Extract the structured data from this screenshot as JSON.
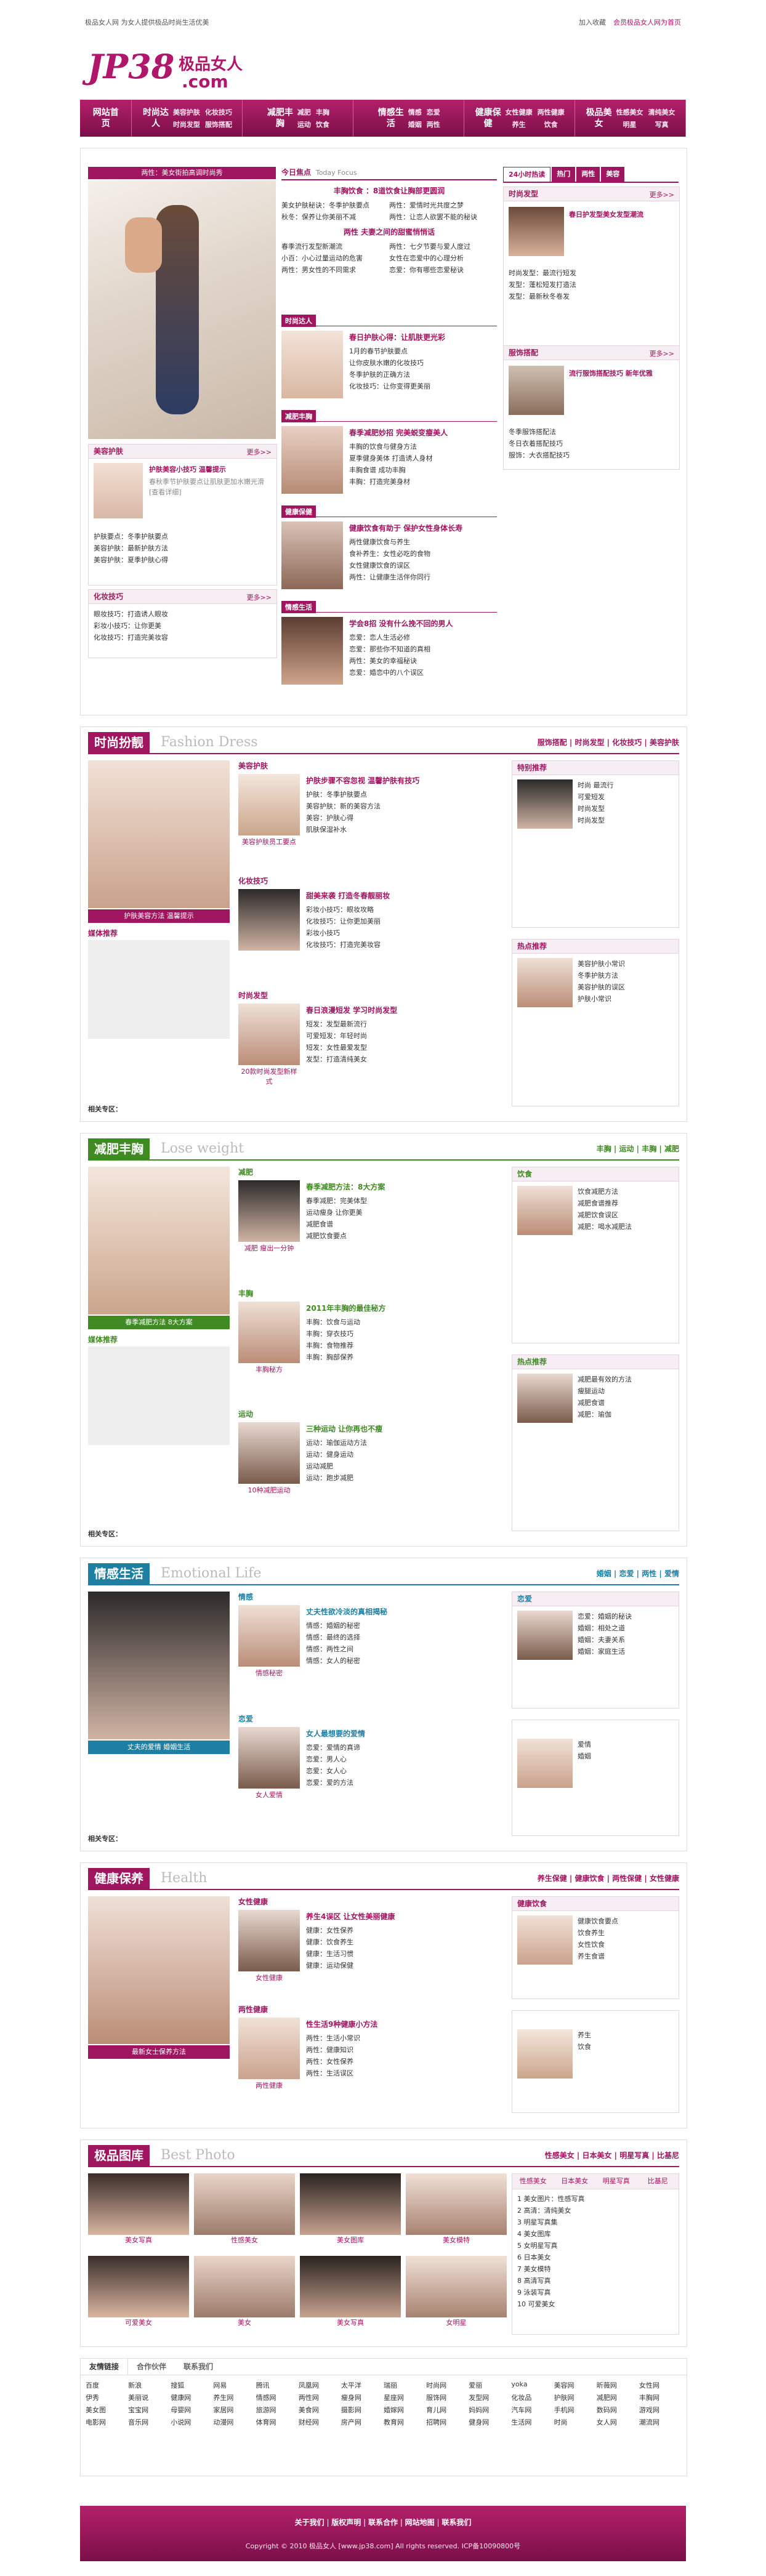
{
  "top": {
    "left": "极品女人网 为女人提供极品时尚生活优美",
    "right1": "加入收藏",
    "right2": "会员极品女人网为首页"
  },
  "logo": {
    "text": "JP38",
    "suffix": "极品女人",
    "com": ".com"
  },
  "nav": [
    {
      "label": "网站首页",
      "subs": []
    },
    {
      "label": "时尚达人",
      "subs": [
        "美容护肤",
        "化妆技巧",
        "时尚发型",
        "服饰搭配"
      ]
    },
    {
      "label": "减肥丰胸",
      "subs": [
        "减肥",
        "丰胸",
        "运动",
        "饮食"
      ]
    },
    {
      "label": "情感生活",
      "subs": [
        "情感",
        "恋爱",
        "婚姻",
        "两性"
      ]
    },
    {
      "label": "健康保健",
      "subs": [
        "女性健康",
        "两性健康",
        "养生",
        "饮食"
      ]
    },
    {
      "label": "极品美女",
      "subs": [
        "性感美女",
        "清纯美女",
        "明星",
        "写真"
      ]
    }
  ],
  "hero": {
    "caption": "两性：美女街拍高调时尚秀"
  },
  "focus": {
    "label": "今日焦点",
    "label_en": "Today Focus",
    "headline": "丰胸饮食 ：8道饮食让胸部更圆润",
    "items": [
      "美女护肤秘诀：冬季护肤要点",
      "两性：爱情时光共度之梦",
      "秋冬：保养让你美丽不减",
      "两性：让恋人欲罢不能的秘诀"
    ],
    "headline2": "两性 夫妻之间的甜蜜悄悄话",
    "items2": [
      "春季流行发型新潮流",
      "两性：七夕节要与爱人度过",
      "小百：小心过量运动的危害",
      "女性在恋爱中的心理分析",
      "两性：男女性的不同需求",
      "恋爱：你有哪些恋爱秘诀"
    ]
  },
  "mid_blocks": [
    {
      "label": "时尚达人",
      "title": "春日护肤心得：让肌肤更光彩",
      "items": [
        "1月的春节护肤要点",
        "让你皮肤水嫩的化妆技巧",
        "冬季护肤的正确方法",
        "化妆技巧：让你变得更美丽"
      ]
    },
    {
      "label": "减肥丰胸",
      "title": "春季减肥妙招 完美蜕变瘦美人",
      "items": [
        "丰胸的饮食与健身方法",
        "夏季健身美体 打造诱人身材",
        "丰胸食谱 成功丰胸",
        "丰胸：打造完美身材"
      ]
    },
    {
      "label": "健康保健",
      "title": "健康饮食有助于 保护女性身体长寿",
      "items": [
        "两性健康饮食与养生",
        "食补养生：女性必吃的食物",
        "女性健康饮食的误区",
        "两性：让健康生活伴你同行"
      ]
    },
    {
      "label": "情感生活",
      "title": "学会8招 没有什么挽不回的男人",
      "items": [
        "恋爱：恋人生活必修",
        "恋爱：那些你不知道的真相",
        "两性：美女的幸福秘诀",
        "恋爱：婚恋中的八个误区"
      ]
    }
  ],
  "left_panels": [
    {
      "title": "美容护肤",
      "more": "更多>>",
      "text": "护肤美容小技巧 温馨提示",
      "desc": "春秋季节护肤要点让肌肤更加水嫩光滑 [查看详细]",
      "items": [
        "护肤要点：冬季护肤要点",
        "美容护肤：最新护肤方法",
        "美容护肤：夏季护肤心得"
      ]
    },
    {
      "title": "化妆技巧",
      "more": "更多>>",
      "items": [
        "眼妆技巧：打造诱人眼妆",
        "彩妆小技巧：让你更美",
        "化妆技巧：打造完美妆容"
      ]
    }
  ],
  "right_tabs": [
    "24小时热读",
    "热门",
    "两性",
    "美容"
  ],
  "right_panels": [
    {
      "title": "时尚发型",
      "more": "更多>>",
      "text": "春日护发型美女发型潮流",
      "items": [
        "时尚发型：最流行短发",
        "发型：蓬松短发打造法",
        "发型：最新秋冬卷发"
      ]
    },
    {
      "title": "服饰搭配",
      "more": "更多>>",
      "text": "流行服饰搭配技巧 新年优雅",
      "items": [
        "冬季服饰搭配法",
        "冬日衣着搭配技巧",
        "服饰：大衣搭配技巧"
      ]
    }
  ],
  "sections": [
    {
      "key": "fashion",
      "cn": "时尚扮靓",
      "en": "Fashion Dress",
      "color": "#a0155f",
      "tabs": [
        "服饰搭配",
        "时尚发型",
        "化妆技巧",
        "美容护肤"
      ],
      "main_caption": "护肤美容方法 温馨提示",
      "sub_label": "媒体推荐",
      "footer": "相关专区：",
      "cols": [
        {
          "head": "美容护肤",
          "title": "护肤步骤不容忽视 温馨护肤有技巧",
          "items": [
            "护肤：冬季护肤要点",
            "美容护肤：新的美容方法",
            "美容：护肤心得",
            "肌肤保湿补水"
          ],
          "caption": "美容护肤员工要点"
        },
        {
          "head": "化妆技巧",
          "title": "甜美来袭 打造冬春靓丽妆",
          "items": [
            "彩妆小技巧：眼妆攻略",
            "化妆技巧：让你更加美丽",
            "彩妆小技巧",
            "化妆技巧：打造完美妆容"
          ],
          "caption": ""
        },
        {
          "head": "时尚发型",
          "title": "春日浪漫短发 学习时尚发型",
          "items": [
            "短发：发型最新流行",
            "可爱短发：年轻时尚",
            "短发：女性最爱发型",
            "发型：打造清纯美女"
          ],
          "caption": "20款时尚发型新样式"
        }
      ],
      "side": [
        {
          "title": "特别推荐",
          "items": [
            "时尚 最流行",
            "可爱短发",
            "时尚发型",
            "时尚发型"
          ]
        },
        {
          "title": "热点推荐",
          "items": [
            "美容护肤小常识",
            "冬季护肤方法",
            "美容护肤的误区",
            "护肤小常识"
          ]
        }
      ]
    },
    {
      "key": "slim",
      "cn": "减肥丰胸",
      "en": "Lose weight",
      "color": "#3f8a22",
      "tabs": [
        "丰胸",
        "运动",
        "丰胸",
        "减肥"
      ],
      "main_caption": "春季减肥方法 8大方案",
      "sub_label": "媒体推荐",
      "footer": "相关专区：",
      "cols": [
        {
          "head": "减肥",
          "title": "春季减肥方法：8大方案",
          "items": [
            "春季减肥：完美体型",
            "运动瘦身 让你更美",
            "减肥食谱",
            "减肥饮食要点"
          ],
          "caption": "减肥 瘦出一分钟"
        },
        {
          "head": "丰胸",
          "title": "2011年丰胸的最佳秘方",
          "items": [
            "丰胸：饮食与运动",
            "丰胸：穿衣技巧",
            "丰胸：食物推荐",
            "丰胸：胸部保养"
          ],
          "caption": "丰胸秘方"
        },
        {
          "head": "运动",
          "title": "三种运动 让你再也不瘦",
          "items": [
            "运动：瑜伽运动方法",
            "运动：健身运动",
            "运动减肥",
            "运动：跑步减肥"
          ],
          "caption": "10种减肥运动"
        }
      ],
      "side": [
        {
          "title": "饮食",
          "items": [
            "饮食减肥方法",
            "减肥食谱推荐",
            "减肥饮食误区",
            "减肥：喝水减肥法"
          ]
        },
        {
          "title": "热点推荐",
          "items": [
            "减肥最有效的方法",
            "瘦腿运动",
            "减肥食谱",
            "减肥：瑜伽"
          ]
        }
      ]
    },
    {
      "key": "emotion",
      "cn": "情感生活",
      "en": "Emotional Life",
      "color": "#1f7fa3",
      "tabs": [
        "婚姻",
        "恋爱",
        "两性",
        "爱情"
      ],
      "main_caption": "丈夫的爱情 婚姻生活",
      "sub_label": "",
      "footer": "相关专区：",
      "cols": [
        {
          "head": "情感",
          "title": "丈夫性欲冷淡的真相揭秘",
          "items": [
            "情感：婚姻的秘密",
            "情感：最终的选择",
            "情感：两性之间",
            "情感：女人的秘密"
          ],
          "caption": "情感秘密"
        },
        {
          "head": "恋爱",
          "title": "女人最想要的爱情",
          "items": [
            "恋爱：爱情的真谛",
            "恋爱：男人心",
            "恋爱：女人心",
            "恋爱：爱的方法"
          ],
          "caption": "女人爱情"
        }
      ],
      "side": [
        {
          "title": "恋爱",
          "items": [
            "恋爱：婚姻的秘诀",
            "婚姻：相处之道",
            "婚姻：夫妻关系",
            "婚姻：家庭生活"
          ]
        },
        {
          "title": "",
          "items": [
            "爱情",
            "婚姻"
          ]
        }
      ]
    },
    {
      "key": "health",
      "cn": "健康保养",
      "en": "Health",
      "color": "#a0155f",
      "tabs": [
        "养生保健",
        "健康饮食",
        "两性保健",
        "女性健康"
      ],
      "main_caption": "最新女士保养方法",
      "sub_label": "",
      "footer": "",
      "cols": [
        {
          "head": "女性健康",
          "title": "养生4误区 让女性美丽健康",
          "items": [
            "健康：女性保养",
            "健康：饮食养生",
            "健康：生活习惯",
            "健康：运动保健"
          ],
          "caption": "女性健康"
        },
        {
          "head": "两性健康",
          "title": "性生活9种健康小方法",
          "items": [
            "两性：生活小常识",
            "两性：健康知识",
            "两性：女性保养",
            "两性：生活误区"
          ],
          "caption": "两性健康"
        }
      ],
      "side": [
        {
          "title": "健康饮食",
          "items": [
            "健康饮食要点",
            "饮食养生",
            "女性饮食",
            "养生食谱"
          ]
        },
        {
          "title": "",
          "items": [
            "养生",
            "饮食"
          ]
        }
      ]
    },
    {
      "key": "photo",
      "cn": "极品图库",
      "en": "Best Photo",
      "color": "#a0155f",
      "tabs": [
        "性感美女",
        "日本美女",
        "明星写真",
        "比基尼"
      ],
      "main_caption": "",
      "sub_label": "",
      "footer": "",
      "cols": [],
      "side": [
        {
          "title": "",
          "items": [
            "1 美女图片：性感写真",
            "2 高清：清纯美女",
            "3 明星写真集",
            "4 美女图库",
            "5 女明星写真",
            "6 日本美女",
            "7 美女模特",
            "8 高清写真",
            "9 泳装写真",
            "10 可爱美女"
          ]
        }
      ]
    }
  ],
  "photo_captions": [
    "美女写真",
    "性感美女",
    "美女图库",
    "美女模特",
    "可爱美女",
    "美女",
    "美女写真",
    "女明星"
  ],
  "links_tabs": [
    "友情链接",
    "合作伙伴",
    "联系我们"
  ],
  "links": [
    "百度",
    "新浪",
    "搜狐",
    "网易",
    "腾讯",
    "凤凰网",
    "太平洋",
    "瑞丽",
    "时尚网",
    "爱丽",
    "yoka",
    "美容网",
    "昕薇网",
    "女性网",
    "伊秀",
    "美丽说",
    "健康网",
    "养生网",
    "情感网",
    "两性网",
    "瘦身网",
    "星座网",
    "服饰网",
    "发型网",
    "化妆品",
    "护肤网",
    "减肥网",
    "丰胸网",
    "美女图",
    "宝宝网",
    "母婴网",
    "家居网",
    "旅游网",
    "美食网",
    "摄影网",
    "婚嫁网",
    "育儿网",
    "妈妈网",
    "汽车网",
    "手机网",
    "数码网",
    "游戏网",
    "电影网",
    "音乐网",
    "小说网",
    "动漫网",
    "体育网",
    "财经网",
    "房产网",
    "教育网",
    "招聘网",
    "健身网",
    "生活网",
    "时尚",
    "女人网",
    "潮流网"
  ],
  "footer": {
    "links": [
      "关于我们",
      "版权声明",
      "联系合作",
      "网站地图",
      "联系我们"
    ],
    "copyright": "Copyright © 2010 极品女人 [www.jp38.com] All rights reserved. ICP备10090800号"
  }
}
